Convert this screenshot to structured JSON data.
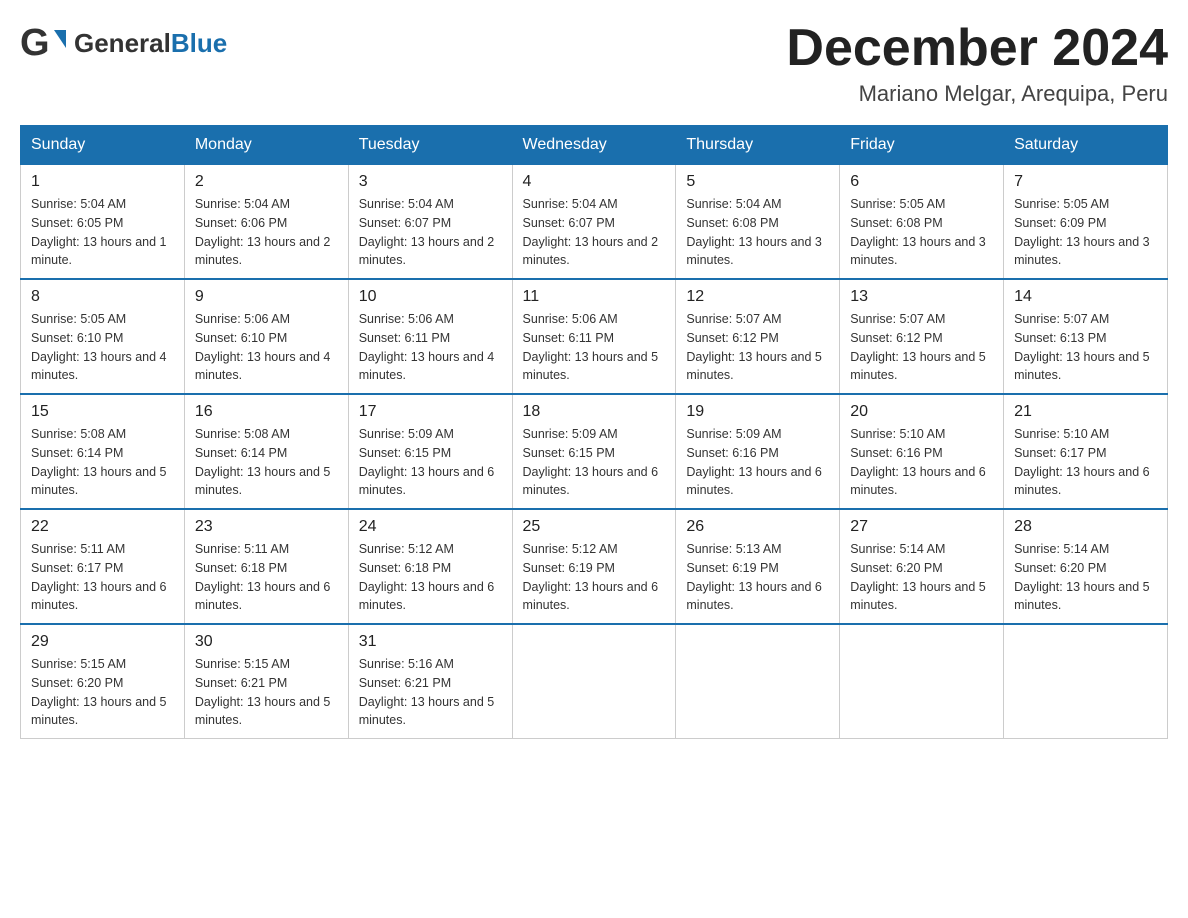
{
  "logo": {
    "text_general": "General",
    "text_blue": "Blue",
    "subtitle": ""
  },
  "header": {
    "title": "December 2024",
    "location": "Mariano Melgar, Arequipa, Peru"
  },
  "days_of_week": [
    "Sunday",
    "Monday",
    "Tuesday",
    "Wednesday",
    "Thursday",
    "Friday",
    "Saturday"
  ],
  "weeks": [
    [
      {
        "day": "1",
        "sunrise": "5:04 AM",
        "sunset": "6:05 PM",
        "daylight": "13 hours and 1 minute."
      },
      {
        "day": "2",
        "sunrise": "5:04 AM",
        "sunset": "6:06 PM",
        "daylight": "13 hours and 2 minutes."
      },
      {
        "day": "3",
        "sunrise": "5:04 AM",
        "sunset": "6:07 PM",
        "daylight": "13 hours and 2 minutes."
      },
      {
        "day": "4",
        "sunrise": "5:04 AM",
        "sunset": "6:07 PM",
        "daylight": "13 hours and 2 minutes."
      },
      {
        "day": "5",
        "sunrise": "5:04 AM",
        "sunset": "6:08 PM",
        "daylight": "13 hours and 3 minutes."
      },
      {
        "day": "6",
        "sunrise": "5:05 AM",
        "sunset": "6:08 PM",
        "daylight": "13 hours and 3 minutes."
      },
      {
        "day": "7",
        "sunrise": "5:05 AM",
        "sunset": "6:09 PM",
        "daylight": "13 hours and 3 minutes."
      }
    ],
    [
      {
        "day": "8",
        "sunrise": "5:05 AM",
        "sunset": "6:10 PM",
        "daylight": "13 hours and 4 minutes."
      },
      {
        "day": "9",
        "sunrise": "5:06 AM",
        "sunset": "6:10 PM",
        "daylight": "13 hours and 4 minutes."
      },
      {
        "day": "10",
        "sunrise": "5:06 AM",
        "sunset": "6:11 PM",
        "daylight": "13 hours and 4 minutes."
      },
      {
        "day": "11",
        "sunrise": "5:06 AM",
        "sunset": "6:11 PM",
        "daylight": "13 hours and 5 minutes."
      },
      {
        "day": "12",
        "sunrise": "5:07 AM",
        "sunset": "6:12 PM",
        "daylight": "13 hours and 5 minutes."
      },
      {
        "day": "13",
        "sunrise": "5:07 AM",
        "sunset": "6:12 PM",
        "daylight": "13 hours and 5 minutes."
      },
      {
        "day": "14",
        "sunrise": "5:07 AM",
        "sunset": "6:13 PM",
        "daylight": "13 hours and 5 minutes."
      }
    ],
    [
      {
        "day": "15",
        "sunrise": "5:08 AM",
        "sunset": "6:14 PM",
        "daylight": "13 hours and 5 minutes."
      },
      {
        "day": "16",
        "sunrise": "5:08 AM",
        "sunset": "6:14 PM",
        "daylight": "13 hours and 5 minutes."
      },
      {
        "day": "17",
        "sunrise": "5:09 AM",
        "sunset": "6:15 PM",
        "daylight": "13 hours and 6 minutes."
      },
      {
        "day": "18",
        "sunrise": "5:09 AM",
        "sunset": "6:15 PM",
        "daylight": "13 hours and 6 minutes."
      },
      {
        "day": "19",
        "sunrise": "5:09 AM",
        "sunset": "6:16 PM",
        "daylight": "13 hours and 6 minutes."
      },
      {
        "day": "20",
        "sunrise": "5:10 AM",
        "sunset": "6:16 PM",
        "daylight": "13 hours and 6 minutes."
      },
      {
        "day": "21",
        "sunrise": "5:10 AM",
        "sunset": "6:17 PM",
        "daylight": "13 hours and 6 minutes."
      }
    ],
    [
      {
        "day": "22",
        "sunrise": "5:11 AM",
        "sunset": "6:17 PM",
        "daylight": "13 hours and 6 minutes."
      },
      {
        "day": "23",
        "sunrise": "5:11 AM",
        "sunset": "6:18 PM",
        "daylight": "13 hours and 6 minutes."
      },
      {
        "day": "24",
        "sunrise": "5:12 AM",
        "sunset": "6:18 PM",
        "daylight": "13 hours and 6 minutes."
      },
      {
        "day": "25",
        "sunrise": "5:12 AM",
        "sunset": "6:19 PM",
        "daylight": "13 hours and 6 minutes."
      },
      {
        "day": "26",
        "sunrise": "5:13 AM",
        "sunset": "6:19 PM",
        "daylight": "13 hours and 6 minutes."
      },
      {
        "day": "27",
        "sunrise": "5:14 AM",
        "sunset": "6:20 PM",
        "daylight": "13 hours and 5 minutes."
      },
      {
        "day": "28",
        "sunrise": "5:14 AM",
        "sunset": "6:20 PM",
        "daylight": "13 hours and 5 minutes."
      }
    ],
    [
      {
        "day": "29",
        "sunrise": "5:15 AM",
        "sunset": "6:20 PM",
        "daylight": "13 hours and 5 minutes."
      },
      {
        "day": "30",
        "sunrise": "5:15 AM",
        "sunset": "6:21 PM",
        "daylight": "13 hours and 5 minutes."
      },
      {
        "day": "31",
        "sunrise": "5:16 AM",
        "sunset": "6:21 PM",
        "daylight": "13 hours and 5 minutes."
      },
      null,
      null,
      null,
      null
    ]
  ]
}
